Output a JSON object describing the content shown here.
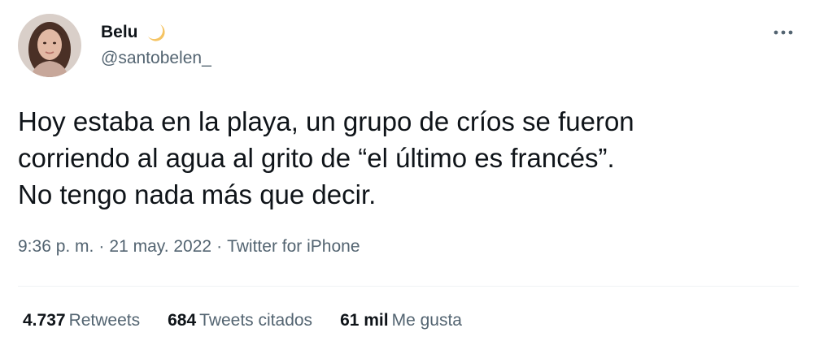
{
  "author": {
    "display_name": "Belu",
    "handle": "@santobelen_",
    "badge_icon": "crescent-moon-icon"
  },
  "tweet": {
    "lines": [
      "Hoy estaba en la playa, un grupo de críos se fueron",
      "corriendo al agua al grito de “el último es francés”.",
      "No tengo nada más que decir."
    ]
  },
  "meta": {
    "time": "9:36 p. m.",
    "separator": "·",
    "date": "21 may. 2022",
    "source": "Twitter for iPhone"
  },
  "stats": {
    "retweets": {
      "count": "4.737",
      "label": "Retweets"
    },
    "quotes": {
      "count": "684",
      "label": "Tweets citados"
    },
    "likes": {
      "count": "61 mil",
      "label": "Me gusta"
    }
  },
  "colors": {
    "text_primary": "#0f1419",
    "text_secondary": "#536471",
    "divider": "#eff3f4",
    "moon": "#f5c463"
  },
  "icons": {
    "more": "more-options-icon",
    "avatar": "profile-avatar"
  }
}
